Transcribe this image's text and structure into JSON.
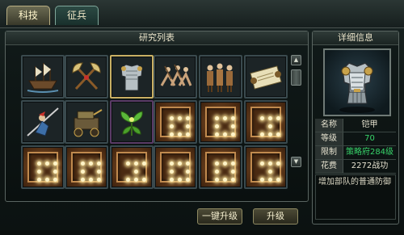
{
  "tabs": [
    {
      "label": "科技"
    },
    {
      "label": "征兵"
    }
  ],
  "research": {
    "title": "研究列表",
    "scroll_up": "▲",
    "scroll_down": "▼"
  },
  "buttons": {
    "one_click_upgrade": "一键升级",
    "upgrade": "升级"
  },
  "detail": {
    "title": "详细信息",
    "rows": [
      {
        "key": "名称",
        "value": "铠甲",
        "color": "#e6e2cf"
      },
      {
        "key": "等级",
        "value": "70",
        "color": "#38d46a"
      },
      {
        "key": "限制",
        "value": "策略府284级",
        "color": "#38d46a"
      },
      {
        "key": "花费",
        "value": "2272战功",
        "color": "#e6e2cf"
      }
    ],
    "description": "增加部队的普通防御"
  },
  "colors": {
    "selected_border": "#c9b064",
    "green_text": "#38d46a",
    "locked_glow": "#ffe79a"
  },
  "cells": [
    {
      "icon": "warship-icon",
      "state": "unlocked"
    },
    {
      "icon": "crossed-axes-icon",
      "state": "unlocked"
    },
    {
      "icon": "armor-icon",
      "state": "selected"
    },
    {
      "icon": "horse-archers-icon",
      "state": "unlocked"
    },
    {
      "icon": "infantry-squad-icon",
      "state": "unlocked"
    },
    {
      "icon": "scroll-map-icon",
      "state": "unlocked"
    },
    {
      "icon": "lancer-icon",
      "state": "unlocked"
    },
    {
      "icon": "siege-cart-icon",
      "state": "unlocked"
    },
    {
      "icon": "herb-plant-icon",
      "state": "unlocked"
    },
    {
      "icon": "locked-rune-icon",
      "state": "locked"
    },
    {
      "icon": "locked-rune-icon",
      "state": "locked"
    },
    {
      "icon": "locked-rune-icon",
      "state": "locked"
    },
    {
      "icon": "locked-rune-icon",
      "state": "locked"
    },
    {
      "icon": "locked-rune-icon",
      "state": "locked"
    },
    {
      "icon": "locked-rune-icon",
      "state": "locked"
    },
    {
      "icon": "locked-rune-icon",
      "state": "locked"
    },
    {
      "icon": "locked-rune-icon",
      "state": "locked"
    },
    {
      "icon": "locked-rune-icon",
      "state": "locked"
    }
  ]
}
